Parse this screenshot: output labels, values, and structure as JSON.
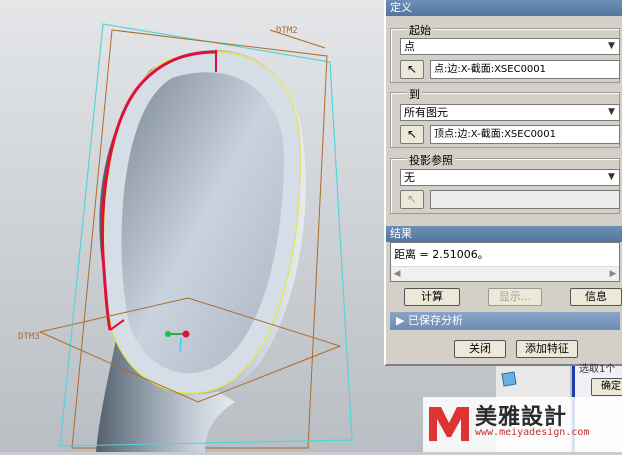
{
  "viewport": {
    "datum_labels": {
      "top": "DTM2",
      "left": "DTM3"
    }
  },
  "dialog": {
    "definition_header": "定义",
    "from_group": {
      "title": "起始",
      "type_value": "点",
      "selection_text": "点:边:X-截面:XSEC0001"
    },
    "to_group": {
      "title": "到",
      "type_value": "所有图元",
      "selection_text": "顶点:边:X-截面:XSEC0001"
    },
    "projection_group": {
      "title": "投影参照",
      "type_value": "无",
      "selection_text": ""
    },
    "results_header": "结果",
    "result_text": "距离 = 2.51006。",
    "buttons": {
      "compute": "计算",
      "show": "显示...",
      "info": "信息"
    },
    "saved_analysis": "已保存分析",
    "footer": {
      "close": "关闭",
      "add_feature": "添加特征"
    }
  },
  "right_panel": {
    "partial_text": "选取1个",
    "ok_label": "确定"
  },
  "watermark": {
    "brand_text": "美雅設計",
    "url": "www.meiyadesign.com"
  },
  "colors": {
    "accent_red": "#e0103c",
    "header_blue": "#5f82ad",
    "datum_orange": "#b06a28",
    "plane_cyan": "#56d4d4"
  }
}
